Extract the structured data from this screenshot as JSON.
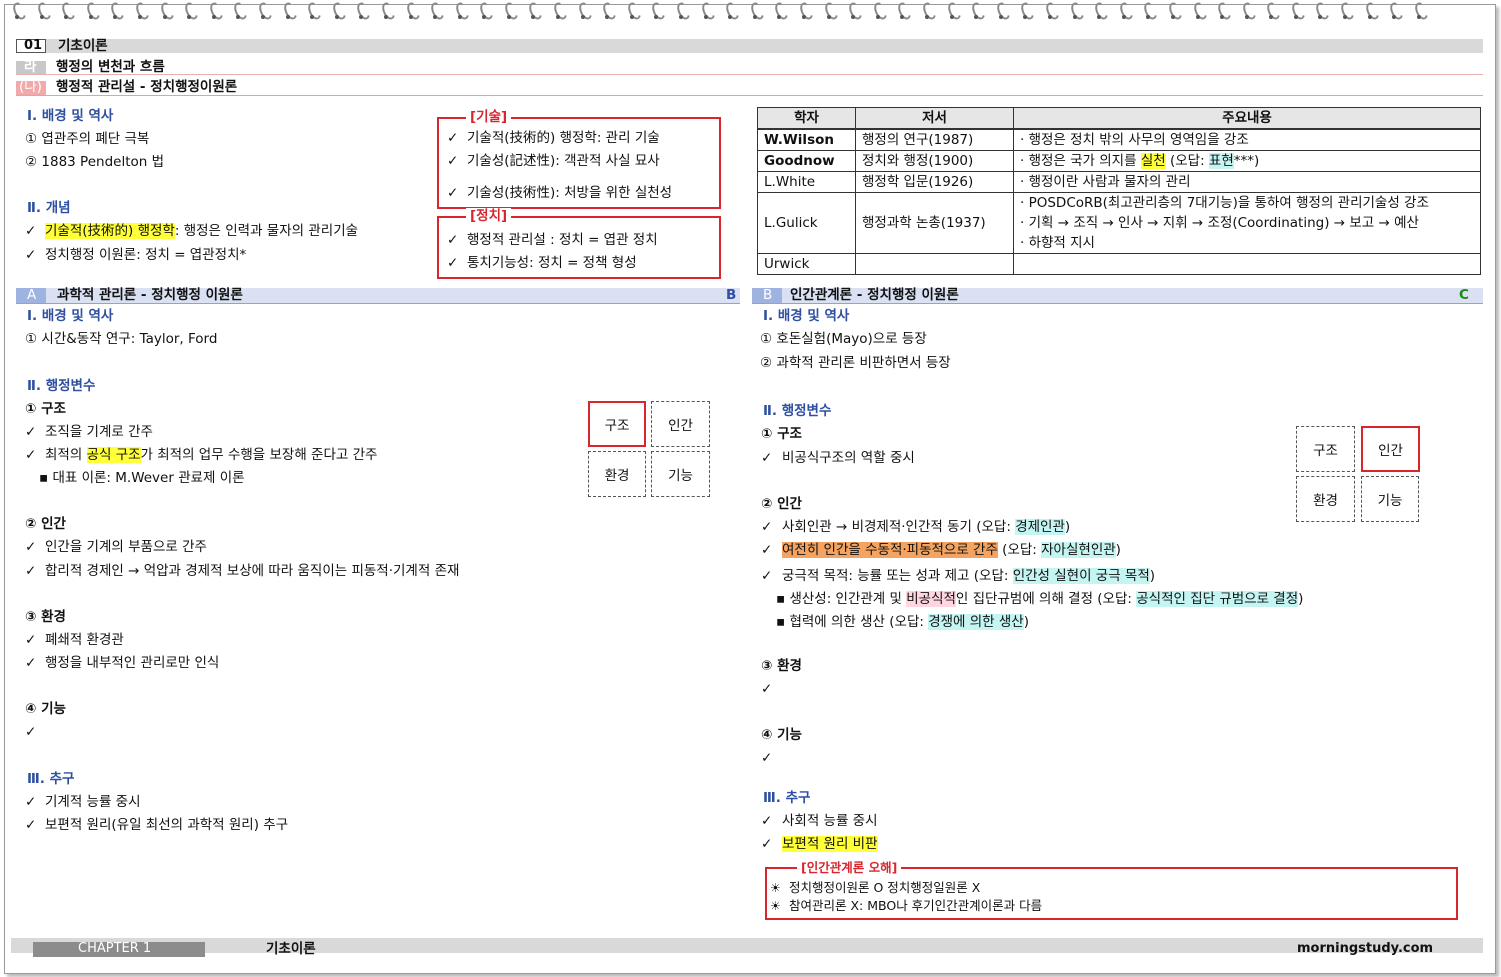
{
  "header": {
    "num": "01",
    "title": "기초이론",
    "sub_letter": "라",
    "sub_title": "행정의 변천과 흐름",
    "subsub_letter": "(나)",
    "subsub_title": "행정적 관리설 - 정치행정이원론"
  },
  "top_left": {
    "sec1_title": "Ⅰ. 배경 및 역사",
    "sec1_items": [
      "① 엽관주의 폐단 극복",
      "② 1883 Pendelton 법"
    ],
    "sec2_title": "Ⅱ. 개념",
    "sec2_item1_hl": "기술적(技術的) 행정학",
    "sec2_item1_rest": ": 행정은 인력과 물자의 관리기술",
    "sec2_item2": "정치행정 이원론: 정치 = 엽관정치*"
  },
  "box_gisul": {
    "title": "[기술]",
    "items": [
      "기술적(技術的) 행정학: 관리 기술",
      "기술성(記述性): 객관적 사실 묘사",
      "기술성(技術性): 처방을 위한 실천성"
    ]
  },
  "box_jeongchi": {
    "title": "[정치]",
    "items": [
      "행정적 관리설 : 정치 = 엽관 정치",
      "통치기능성: 정치 = 정책 형성"
    ]
  },
  "table": {
    "headers": [
      "학자",
      "저서",
      "주요내용"
    ],
    "r1": {
      "name": "W.Wilson",
      "book": "행정의 연구(1987)",
      "content": "· 행정은 정치 밖의 사무의 영역임을 강조"
    },
    "r2": {
      "name": "Goodnow",
      "book": "정치와 행정(1900)",
      "c_a": "· 행정은 국가 의지를 ",
      "c_hl1": "실천",
      "c_b": " (오답: ",
      "c_hl2": "표현",
      "c_c": "***)"
    },
    "r3": {
      "name": "L.White",
      "book": "행정학 입문(1926)",
      "content": "· 행정이란 사람과 물자의 관리"
    },
    "r4": {
      "name": "L.Gulick",
      "book": "행정과학 논총(1937)",
      "lines": [
        "· POSDCoRB(최고관리층의 7대기능)을 통하여 행정의 관리기술성 강조",
        "· 기획 → 조직 → 인사 → 지휘 → 조정(Coordinating) → 보고 → 예산",
        "· 하향적 지시"
      ]
    },
    "r5": {
      "name": "Urwick",
      "book": "",
      "content": ""
    }
  },
  "left": {
    "bar_letter": "A",
    "bar_title": "과학적 관리론 - 정치행정 이원론",
    "bar_end": "B",
    "s1_title": "Ⅰ. 배경 및 역사",
    "s1_item": "① 시간&동작 연구: Taylor, Ford",
    "s2_title": "Ⅱ. 행정변수",
    "g1_title": "① 구조",
    "g1_i1": "조직을 기계로 간주",
    "g1_i2_a": "최적의 ",
    "g1_i2_hl": "공식 구조",
    "g1_i2_b": "가 최적의 업무 수행을 보장해 준다고 간주",
    "g1_i3": "▪ 대표 이론: M.Wever 관료제 이론",
    "g2_title": "② 인간",
    "g2_i1": "인간을 기계의 부품으로 간주",
    "g2_i2": "합리적 경제인 → 억압과 경제적 보상에 따라 움직이는 피동적·기계적 존재",
    "g3_title": "③ 환경",
    "g3_i1": "폐쇄적 환경관",
    "g3_i2": "행정을 내부적인 관리로만 인식",
    "g4_title": "④ 기능",
    "s3_title": "Ⅲ. 추구",
    "s3_i1": "기계적 능률 중시",
    "s3_i2": "보편적 원리(유일 최선의 과학적 원리) 추구",
    "boxes": [
      "구조",
      "인간",
      "환경",
      "기능"
    ]
  },
  "right": {
    "bar_letter": "B",
    "bar_title": "인간관계론 - 정치행정 이원론",
    "bar_end": "C",
    "s1_title": "Ⅰ. 배경 및 역사",
    "s1_i1": "① 호돈실험(Mayo)으로 등장",
    "s1_i2": "② 과학적 관리론 비판하면서 등장",
    "s2_title": "Ⅱ. 행정변수",
    "g1_title": "① 구조",
    "g1_i1": "비공식구조의 역할 중시",
    "g2_title": "② 인간",
    "g2_i1_a": "사회인관 → 비경제적·인간적 동기 (오답: ",
    "g2_i1_hl": "경제인관",
    "g2_i1_b": ")",
    "g2_i2_hl": "여전히 인간을 수동적·피동적으로 간주",
    "g2_i2_a": " (오답: ",
    "g2_i2_hl2": "자아실현인관",
    "g2_i2_b": ")",
    "g2_i3_a": "궁극적 목적: 능률 또는 성과 제고 (오답: ",
    "g2_i3_hl": "인간성 실현이 궁극 목적",
    "g2_i3_b": ")",
    "g2_i4_a": "▪ 생산성: 인간관계 및 ",
    "g2_i4_hl1": "비공식적",
    "g2_i4_b": "인 집단규범에 의해 결정 (오답: ",
    "g2_i4_hl2": "공식적인 집단 규범으로 결정",
    "g2_i4_c": ")",
    "g2_i5_a": "▪ 협력에 의한 생산 (오답: ",
    "g2_i5_hl": "경쟁에 의한 생산",
    "g2_i5_b": ")",
    "g3_title": "③ 환경",
    "g4_title": "④ 기능",
    "s3_title": "Ⅲ. 추구",
    "s3_i1": "사회적 능률 중시",
    "s3_i2_hl": "보편적 원리 비판",
    "boxes": [
      "구조",
      "인간",
      "환경",
      "기능"
    ],
    "note_title": "[인간관계론 오해]",
    "note_items": [
      "정치행정이원론 O 정치행정일원론 X",
      "참여관리론 X: MBO나 후기인간관계이론과 다름"
    ]
  },
  "footer": {
    "chapter": "CHAPTER 1",
    "title": "기초이론",
    "site": "morningstudy.com"
  },
  "check_mark": "✓",
  "sun_mark": "☀",
  "colors": {
    "accent_blue": "#2e4fa2",
    "red": "#d9262d",
    "highlight_yellow": "#ffff3a",
    "highlight_orange": "#f4a460",
    "highlight_cyan": "#c5f5f2"
  }
}
